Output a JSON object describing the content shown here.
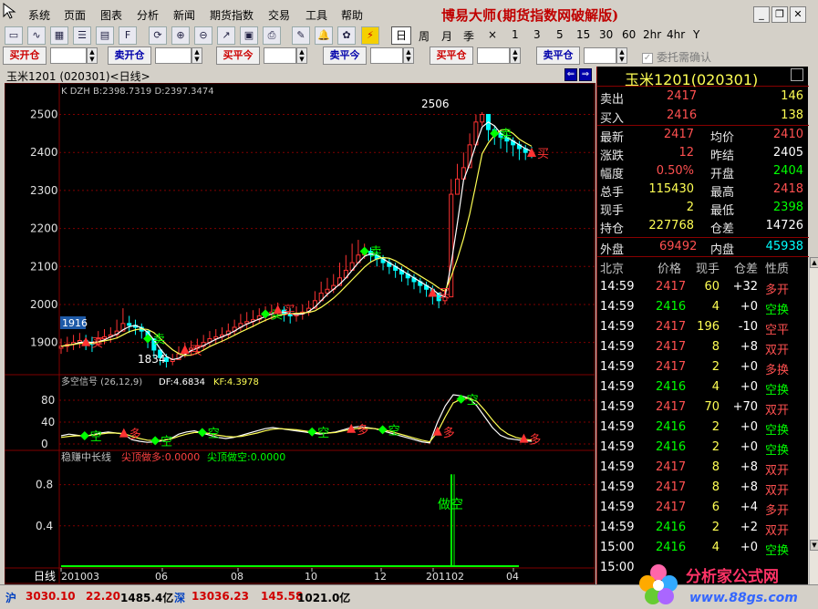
{
  "menu": [
    "系统",
    "页面",
    "图表",
    "分析",
    "新闻",
    "期货指数",
    "交易",
    "工具",
    "帮助"
  ],
  "app_title": "博易大师(期货指数网破解版)",
  "toolbar": {
    "periods": [
      "日",
      "周",
      "月",
      "季",
      "×",
      "1",
      "3",
      "5",
      "15",
      "30",
      "60",
      "2hr",
      "4hr",
      "Y"
    ]
  },
  "orders": {
    "buy_open": "买开仓",
    "sell_open": "卖开仓",
    "buy_close_today": "买平今",
    "sell_close_today": "卖平今",
    "buy_close": "买平仓",
    "sell_close": "卖平仓",
    "confirm_label": "委托需确认"
  },
  "chart": {
    "title": "玉米1201 (020301)<日线>",
    "k_info": "K  DZH B:2398.7319 D:2397.3474",
    "signal_header": "多空信号 (26,12,9)",
    "signal_df": "DF:4.6834",
    "signal_kf": "KF:4.3978",
    "bottom_header": "稳赚中长线",
    "bottom_buy": "尖顶做多:0.0000",
    "bottom_sell": "尖顶做空:0.0000",
    "bottom_label": "做空",
    "high_label": "2506",
    "low_label": "1834",
    "current_box": "1916",
    "period_label": "日线",
    "buy_text": "买",
    "sell_text": "卖",
    "empty_text": "空",
    "long_text": "多"
  },
  "chart_data": [
    {
      "type": "candlestick",
      "title": "玉米1201 (020301)<日线>",
      "ylim": [
        1820,
        2530
      ],
      "yticks": [
        1900,
        2000,
        2100,
        2200,
        2300,
        2400,
        2500
      ],
      "xticks": [
        "201003",
        "06",
        "08",
        "10",
        "12",
        "201102",
        "04"
      ],
      "close": [
        1890,
        1895,
        1900,
        1905,
        1900,
        1895,
        1910,
        1915,
        1920,
        1930,
        1950,
        1945,
        1940,
        1930,
        1910,
        1880,
        1860,
        1850,
        1855,
        1870,
        1880,
        1885,
        1890,
        1900,
        1910,
        1915,
        1920,
        1930,
        1940,
        1950,
        1955,
        1960,
        1970,
        1975,
        1980,
        1985,
        1975,
        1970,
        1975,
        1980,
        1990,
        2010,
        2030,
        2040,
        2050,
        2070,
        2090,
        2110,
        2130,
        2140,
        2130,
        2120,
        2110,
        2100,
        2090,
        2080,
        2070,
        2060,
        2050,
        2040,
        2030,
        2010,
        2020,
        2290,
        2330,
        2360,
        2420,
        2480,
        2500,
        2460,
        2450,
        2440,
        2430,
        2420,
        2410,
        2400,
        2398
      ],
      "high": [
        1910,
        1915,
        1920,
        1925,
        1920,
        1915,
        1930,
        1935,
        1940,
        1960,
        1990,
        1970,
        1960,
        1950,
        1930,
        1900,
        1880,
        1870,
        1870,
        1890,
        1900,
        1905,
        1910,
        1920,
        1930,
        1935,
        1940,
        1950,
        1960,
        1975,
        1980,
        1985,
        1990,
        1995,
        2000,
        2005,
        1995,
        1990,
        1995,
        2000,
        2010,
        2035,
        2060,
        2070,
        2080,
        2110,
        2130,
        2160,
        2170,
        2160,
        2150,
        2140,
        2130,
        2120,
        2110,
        2100,
        2090,
        2080,
        2070,
        2060,
        2050,
        2030,
        2040,
        2330,
        2370,
        2400,
        2450,
        2500,
        2506,
        2480,
        2470,
        2460,
        2450,
        2440,
        2430,
        2420,
        2415
      ],
      "low": [
        1870,
        1875,
        1880,
        1885,
        1880,
        1875,
        1890,
        1895,
        1900,
        1910,
        1930,
        1925,
        1920,
        1910,
        1885,
        1860,
        1840,
        1834,
        1840,
        1855,
        1860,
        1865,
        1870,
        1880,
        1890,
        1895,
        1900,
        1910,
        1920,
        1930,
        1935,
        1940,
        1950,
        1955,
        1960,
        1965,
        1955,
        1950,
        1955,
        1960,
        1970,
        1990,
        2010,
        2020,
        2030,
        2050,
        2070,
        2090,
        2110,
        2120,
        2110,
        2100,
        2090,
        2080,
        2070,
        2060,
        2050,
        2040,
        2030,
        2020,
        2000,
        1990,
        2000,
        2250,
        2290,
        2330,
        2390,
        2440,
        2470,
        2430,
        2420,
        2410,
        2400,
        2390,
        2380,
        2380,
        2385
      ]
    },
    {
      "type": "line",
      "title": "多空信号 (26,12,9)",
      "ylim": [
        -10,
        110
      ],
      "yticks": [
        0,
        40,
        80
      ],
      "series": [
        {
          "name": "DF",
          "values": [
            15,
            18,
            16,
            14,
            17,
            20,
            22,
            20,
            18,
            8,
            5,
            3,
            4,
            6,
            10,
            18,
            22,
            24,
            20,
            16,
            12,
            10,
            12,
            16,
            20,
            24,
            28,
            30,
            28,
            26,
            24,
            22,
            20,
            18,
            20,
            22,
            26,
            30,
            32,
            30,
            28,
            24,
            20,
            16,
            12,
            8,
            4,
            2,
            40,
            70,
            90,
            88,
            84,
            70,
            50,
            30,
            16,
            10,
            8,
            6,
            5
          ]
        },
        {
          "name": "KF",
          "values": [
            12,
            14,
            15,
            15,
            16,
            18,
            20,
            20,
            19,
            14,
            10,
            7,
            6,
            7,
            9,
            14,
            18,
            21,
            21,
            19,
            16,
            14,
            13,
            14,
            17,
            20,
            24,
            27,
            28,
            27,
            26,
            24,
            22,
            20,
            20,
            21,
            24,
            27,
            29,
            29,
            28,
            26,
            23,
            19,
            15,
            11,
            7,
            4,
            22,
            50,
            75,
            82,
            84,
            78,
            62,
            44,
            28,
            18,
            12,
            9,
            7
          ]
        }
      ]
    },
    {
      "type": "bar",
      "title": "稳赚中长线",
      "ylim": [
        0,
        1
      ],
      "yticks": [
        0.4,
        0.8
      ],
      "series": [
        {
          "name": "尖顶做多",
          "values": [
            0
          ]
        },
        {
          "name": "尖顶做空",
          "values": [
            0
          ]
        }
      ],
      "spike_value": 0.9
    }
  ],
  "quote": {
    "name": "玉米1201(020301)",
    "ask": {
      "label": "卖出",
      "price": "2417",
      "vol": "146"
    },
    "bid": {
      "label": "买入",
      "price": "2416",
      "vol": "138"
    },
    "rows": [
      {
        "l1": "最新",
        "v1": "2417",
        "l2": "均价",
        "v2": "2410"
      },
      {
        "l1": "涨跌",
        "v1": "12",
        "l2": "昨结",
        "v2": "2405"
      },
      {
        "l1": "幅度",
        "v1": "0.50%",
        "l2": "开盘",
        "v2": "2404"
      },
      {
        "l1": "总手",
        "v1": "115430",
        "l2": "最高",
        "v2": "2418"
      },
      {
        "l1": "现手",
        "v1": "2",
        "l2": "最低",
        "v2": "2398"
      },
      {
        "l1": "持仓",
        "v1": "227768",
        "l2": "仓差",
        "v2": "14726"
      }
    ],
    "outside": {
      "label": "外盘",
      "value": "69492"
    },
    "inside": {
      "label": "内盘",
      "value": "45938"
    },
    "ticks_header": [
      "北京",
      "价格",
      "现手",
      "仓差",
      "性质"
    ],
    "ticks": [
      {
        "time": "14:59",
        "price": "2417",
        "vol": "60",
        "diff": "+32",
        "nature": "多开"
      },
      {
        "time": "14:59",
        "price": "2416",
        "vol": "4",
        "diff": "+0",
        "nature": "空换"
      },
      {
        "time": "14:59",
        "price": "2417",
        "vol": "196",
        "diff": "-10",
        "nature": "空平"
      },
      {
        "time": "14:59",
        "price": "2417",
        "vol": "8",
        "diff": "+8",
        "nature": "双开"
      },
      {
        "time": "14:59",
        "price": "2417",
        "vol": "2",
        "diff": "+0",
        "nature": "多换"
      },
      {
        "time": "14:59",
        "price": "2416",
        "vol": "4",
        "diff": "+0",
        "nature": "空换"
      },
      {
        "time": "14:59",
        "price": "2417",
        "vol": "70",
        "diff": "+70",
        "nature": "双开"
      },
      {
        "time": "14:59",
        "price": "2416",
        "vol": "2",
        "diff": "+0",
        "nature": "空换"
      },
      {
        "time": "14:59",
        "price": "2416",
        "vol": "2",
        "diff": "+0",
        "nature": "空换"
      },
      {
        "time": "14:59",
        "price": "2417",
        "vol": "8",
        "diff": "+8",
        "nature": "双开"
      },
      {
        "time": "14:59",
        "price": "2417",
        "vol": "8",
        "diff": "+8",
        "nature": "双开"
      },
      {
        "time": "14:59",
        "price": "2417",
        "vol": "6",
        "diff": "+4",
        "nature": "多开"
      },
      {
        "time": "14:59",
        "price": "2416",
        "vol": "2",
        "diff": "+2",
        "nature": "双开"
      },
      {
        "time": "15:00",
        "price": "2416",
        "vol": "4",
        "diff": "+0",
        "nature": "空换"
      },
      {
        "time": "15:00",
        "price": "",
        "vol": "",
        "diff": "",
        "nature": ""
      }
    ]
  },
  "status": {
    "sh_label": "沪",
    "sh_index": "3030.10",
    "sh_change": "22.20",
    "sh_amount": "1485.4亿",
    "sz_label": "深",
    "sz_index": "13036.23",
    "sz_change": "145.58",
    "sz_amount": "1021.0亿"
  },
  "watermark": {
    "line1": "分析家公式网",
    "line2": "www.88gs.com"
  },
  "colors": {
    "up": "#ff3333",
    "down": "#00ffff",
    "green": "#00ff00",
    "yellow": "#ffff54",
    "frame": "#800000",
    "bg": "#000000"
  }
}
